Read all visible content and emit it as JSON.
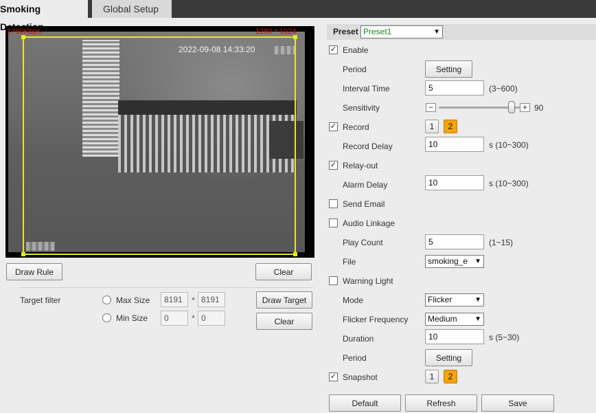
{
  "tabs": [
    {
      "label": "Smoking Detection",
      "active": true
    },
    {
      "label": "Global Setup",
      "active": false
    }
  ],
  "video": {
    "bitrate": "1760Kbps",
    "resolution": "1280 * 1024",
    "timestamp": "2022-09-08 14:33:20",
    "rule_color": "#e8e820"
  },
  "left_controls": {
    "draw_rule": "Draw Rule",
    "clear": "Clear",
    "target_filter_label": "Target filter",
    "max_size_label": "Max Size",
    "max_w": "8191",
    "max_h": "8191",
    "min_size_label": "Min Size",
    "min_w": "0",
    "min_h": "0",
    "separator": "*",
    "draw_target": "Draw Target",
    "clear2": "Clear"
  },
  "preset": {
    "label": "Preset",
    "value": "Preset1"
  },
  "settings": {
    "enable": {
      "label": "Enable",
      "checked": true
    },
    "period": {
      "label": "Period",
      "button": "Setting"
    },
    "interval": {
      "label": "Interval Time",
      "value": "5",
      "hint": "(3~600)"
    },
    "sensitivity": {
      "label": "Sensitivity",
      "value": "90",
      "level": 0.9
    },
    "record": {
      "label": "Record",
      "checked": true,
      "channels": [
        "1",
        "2"
      ]
    },
    "record_delay": {
      "label": "Record Delay",
      "value": "10",
      "hint": "s (10~300)"
    },
    "relay_out": {
      "label": "Relay-out",
      "checked": true
    },
    "alarm_delay": {
      "label": "Alarm Delay",
      "value": "10",
      "hint": "s (10~300)"
    },
    "send_email": {
      "label": "Send Email",
      "checked": false
    },
    "audio_linkage": {
      "label": "Audio Linkage",
      "checked": false
    },
    "play_count": {
      "label": "Play Count",
      "value": "5",
      "hint": "(1~15)"
    },
    "file": {
      "label": "File",
      "value": "smoking_e"
    },
    "warning_light": {
      "label": "Warning Light",
      "checked": false
    },
    "mode": {
      "label": "Mode",
      "value": "Flicker"
    },
    "flicker_frequency": {
      "label": "Flicker Frequency",
      "value": "Medium"
    },
    "duration": {
      "label": "Duration",
      "value": "10",
      "hint": "s (5~30)"
    },
    "period2": {
      "label": "Period",
      "button": "Setting"
    },
    "snapshot": {
      "label": "Snapshot",
      "checked": true,
      "channels": [
        "1",
        "2"
      ]
    }
  },
  "footer": {
    "default": "Default",
    "refresh": "Refresh",
    "save": "Save"
  },
  "icons": {
    "check": "✓",
    "chevron": "▼",
    "minus": "−",
    "plus": "+"
  }
}
